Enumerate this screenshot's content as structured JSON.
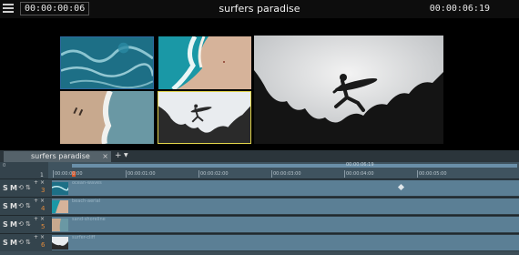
{
  "topbar": {
    "menu_icon": "hamburger-menu-icon",
    "timecode_current": "00:00:00:06",
    "title": "surfers paradise",
    "timecode_duration": "00:00:06:19"
  },
  "preview": {
    "thumbnails": [
      {
        "name": "ocean-waves",
        "selected_border": "#2d6aa0"
      },
      {
        "name": "beach-aerial",
        "selected_border": null
      },
      {
        "name": "sand-shoreline",
        "selected_border": null
      },
      {
        "name": "surfer-cliff",
        "selected_border": "#e2d44a"
      }
    ],
    "main_frame": "surfer-cliff"
  },
  "timeline": {
    "tab_label": "surfers paradise",
    "tab_close": "×",
    "tab_add": "+",
    "tab_menu": "▼",
    "ruler": {
      "left_label": "0",
      "number": "1",
      "range_timecode": "00:00:06:19",
      "ticks": [
        "00:00:00:00",
        "00:00:01:00",
        "00:00:02:00",
        "00:00:03:00",
        "00:00:04:00",
        "00:00:05:00"
      ]
    },
    "tracks": [
      {
        "number": "3",
        "clip": "ocean-waves"
      },
      {
        "number": "4",
        "clip": "beach-aerial"
      },
      {
        "number": "5",
        "clip": "sand-shoreline"
      },
      {
        "number": "6",
        "clip": "surfer-cliff"
      }
    ],
    "track_controls": {
      "solo": "S",
      "mute": "M",
      "lock_icon": "⟲",
      "order_icon": "⇅",
      "plus": "+",
      "x": "×"
    }
  },
  "colors": {
    "accent_blue": "#2d6aa0",
    "accent_yellow": "#e2d44a",
    "playhead": "#e05a2b",
    "clip": "#5b7f95"
  }
}
